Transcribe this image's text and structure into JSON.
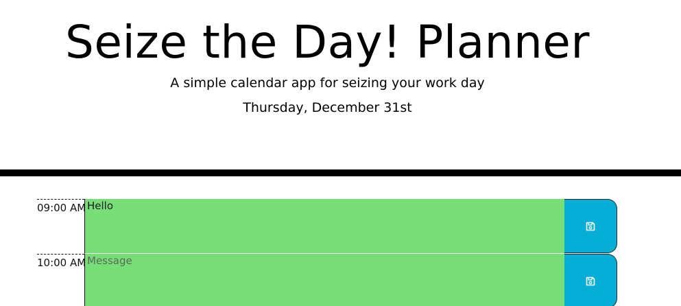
{
  "header": {
    "title": "Seize the Day! Planner",
    "subtitle": "A simple calendar app for seizing your work day",
    "current_day": "Thursday, December 31st"
  },
  "time_blocks": [
    {
      "hour": "09:00 AM",
      "value": "Hello",
      "placeholder": "Message",
      "status": "future",
      "color": "#77dd77"
    },
    {
      "hour": "10:00 AM",
      "value": "",
      "placeholder": "Message",
      "status": "future",
      "color": "#77dd77"
    }
  ],
  "save_button": {
    "icon": "save-icon",
    "color": "#06aed5"
  }
}
